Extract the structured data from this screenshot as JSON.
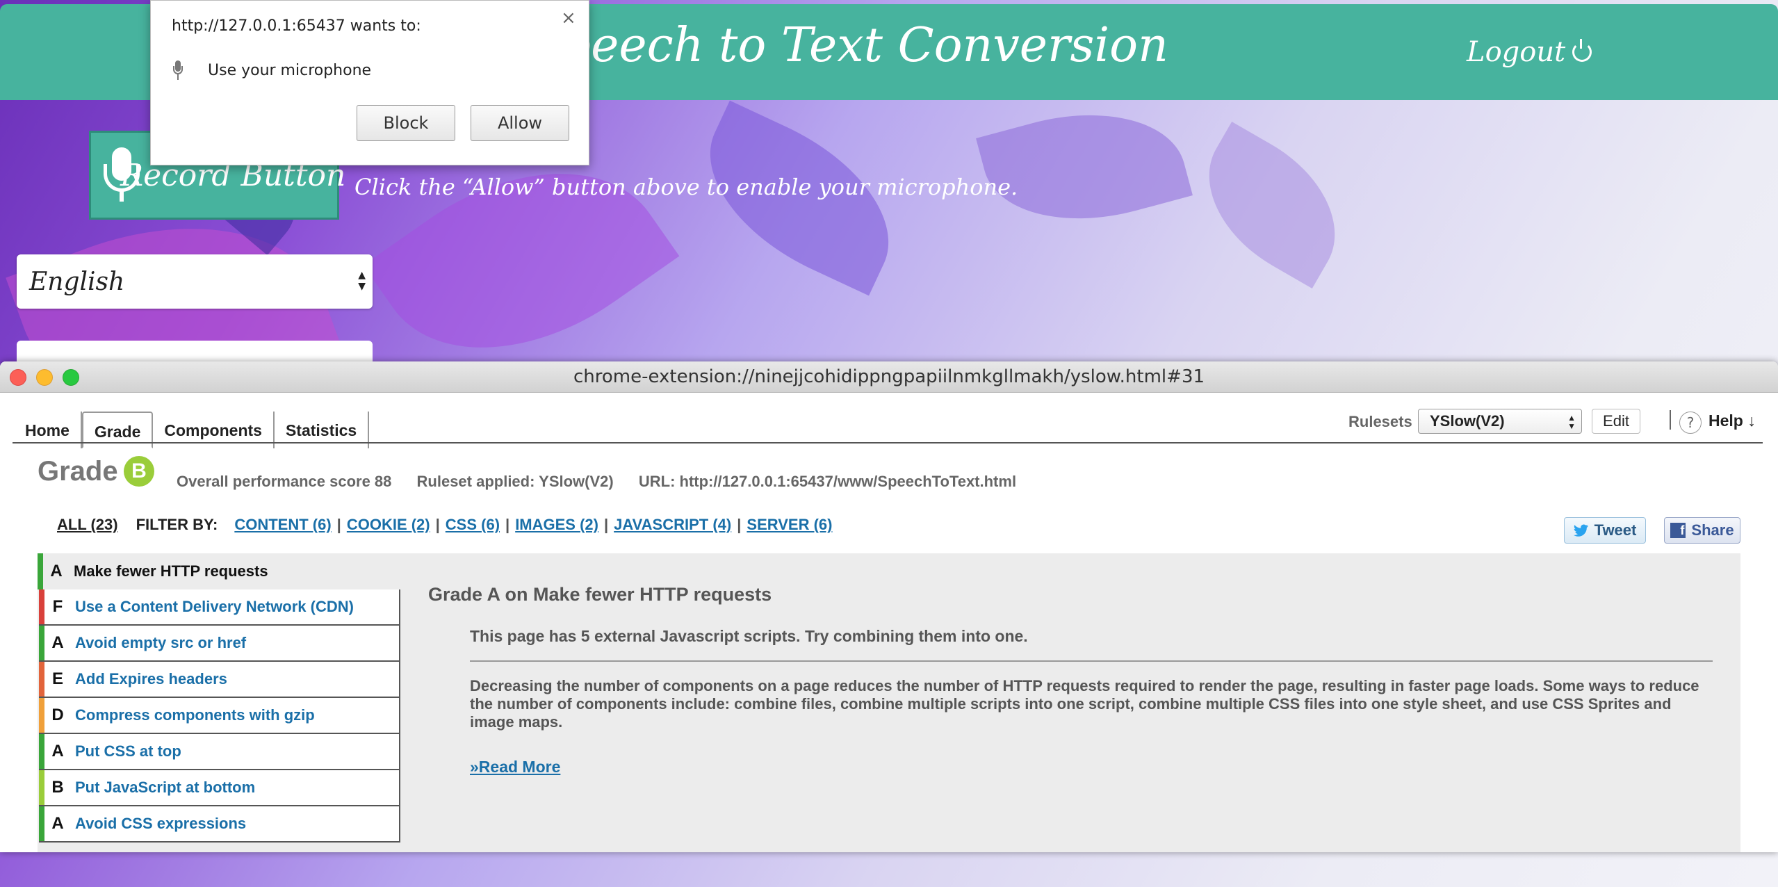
{
  "app": {
    "title": "Speech to Text Conversion",
    "logout_label": "Logout",
    "record_label": "Record Button",
    "hint": "Click the “Allow” button above to enable your microphone.",
    "language": "English",
    "accent_color": "#47b39e"
  },
  "permission_popup": {
    "title": "http://127.0.0.1:65437 wants to:",
    "permission": "Use your microphone",
    "block_label": "Block",
    "allow_label": "Allow",
    "close_label": "×"
  },
  "yslow": {
    "window_title": "chrome-extension://ninejjcohidippngpapiilnmkgllmakh/yslow.html#31",
    "tabs": [
      {
        "label": "Home"
      },
      {
        "label": "Grade",
        "active": true
      },
      {
        "label": "Components"
      },
      {
        "label": "Statistics"
      }
    ],
    "rulesets_label": "Rulesets",
    "ruleset_selected": "YSlow(V2)",
    "edit_label": "Edit",
    "help_label": "Help ↓",
    "help_icon": "?",
    "grade_label": "Grade",
    "grade": "B",
    "grade_color": "#9acd3a",
    "overall_score": "Overall performance score 88",
    "ruleset_applied": "Ruleset applied: YSlow(V2)",
    "url": "URL: http://127.0.0.1:65437/www/SpeechToText.html",
    "filter_all": "ALL (23)",
    "filter_by": "FILTER BY:",
    "filters": [
      {
        "label": "CONTENT (6)"
      },
      {
        "label": "COOKIE (2)"
      },
      {
        "label": "CSS (6)"
      },
      {
        "label": "IMAGES (2)"
      },
      {
        "label": "JAVASCRIPT (4)"
      },
      {
        "label": "SERVER (6)"
      }
    ],
    "tweet_label": "Tweet",
    "share_label": "Share",
    "rules": [
      {
        "grade": "A",
        "name": "Make fewer HTTP requests",
        "color": "#3aa63a",
        "active": true
      },
      {
        "grade": "F",
        "name": "Use a Content Delivery Network (CDN)",
        "color": "#d9413b"
      },
      {
        "grade": "A",
        "name": "Avoid empty src or href",
        "color": "#3aa63a"
      },
      {
        "grade": "E",
        "name": "Add Expires headers",
        "color": "#e2643b"
      },
      {
        "grade": "D",
        "name": "Compress components with gzip",
        "color": "#f0a03a"
      },
      {
        "grade": "A",
        "name": "Put CSS at top",
        "color": "#3aa63a"
      },
      {
        "grade": "B",
        "name": "Put JavaScript at bottom",
        "color": "#9acd3a"
      },
      {
        "grade": "A",
        "name": "Avoid CSS expressions",
        "color": "#3aa63a"
      }
    ],
    "detail": {
      "title": "Grade A on Make fewer HTTP requests",
      "message": "This page has 5 external Javascript scripts. Try combining them into one.",
      "description": "Decreasing the number of components on a page reduces the number of HTTP requests required to render the page, resulting in faster page loads. Some ways to reduce the number of components include: combine files, combine multiple scripts into one script, combine multiple CSS files into one style sheet, and use CSS Sprites and image maps.",
      "read_more": "»Read More"
    }
  }
}
